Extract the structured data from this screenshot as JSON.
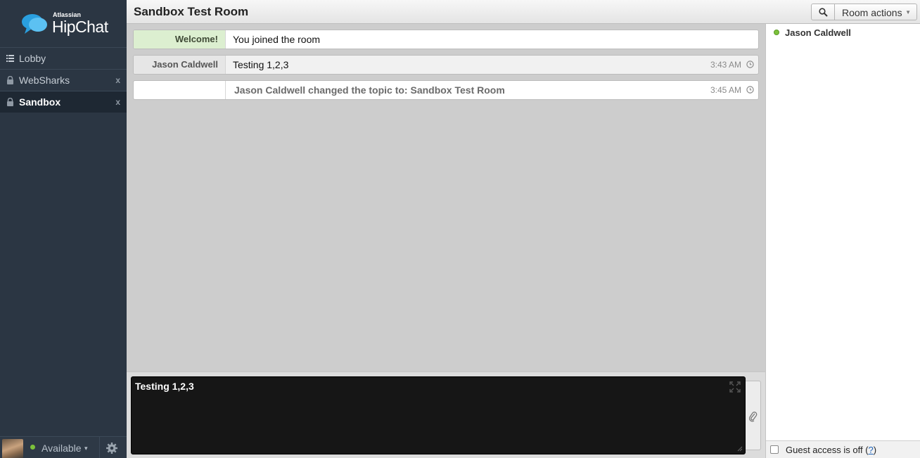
{
  "app": {
    "brand_small": "Atlassian",
    "brand_name": "HipChat"
  },
  "sidebar": {
    "items": [
      {
        "label": "Lobby",
        "icon": "list-icon",
        "closable": false,
        "active": false
      },
      {
        "label": "WebSharks",
        "icon": "lock-icon",
        "closable": true,
        "active": false
      },
      {
        "label": "Sandbox",
        "icon": "lock-icon",
        "closable": true,
        "active": true
      }
    ],
    "close_glyph": "x",
    "status": "Available"
  },
  "header": {
    "room_title": "Sandbox Test Room",
    "room_actions_label": "Room actions"
  },
  "messages": [
    {
      "sender": "Welcome!",
      "text": "You joined the room",
      "time": ""
    },
    {
      "sender": "Jason Caldwell",
      "text": "Testing 1,2,3",
      "time": "3:43 AM"
    },
    {
      "sender": "",
      "text": "Jason Caldwell changed the topic to: Sandbox Test Room",
      "time": "3:45 AM"
    }
  ],
  "composer": {
    "value": "Testing 1,2,3"
  },
  "roster": {
    "members": [
      {
        "name": "Jason Caldwell",
        "status_color": "#7cc13b"
      }
    ],
    "guest_access_text": "Guest access is off (",
    "guest_help": "?",
    "guest_access_close": ")"
  },
  "colors": {
    "sidebar_bg": "#2b3643",
    "welcome_bg": "#dcefd0",
    "available": "#7cc13b",
    "brand_blue": "#2a9fdf"
  }
}
